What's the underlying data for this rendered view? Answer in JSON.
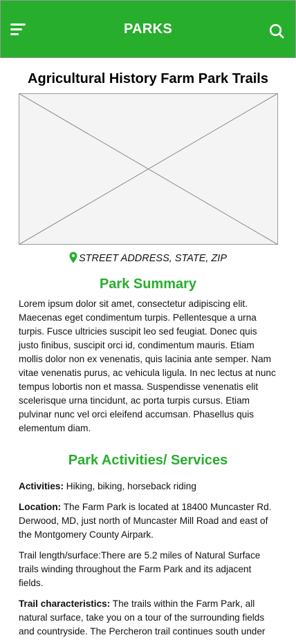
{
  "header": {
    "title": "PARKS",
    "menu_icon": "hamburger-menu-icon",
    "search_icon": "search-icon",
    "bg_color": "#27ae2d"
  },
  "page": {
    "title": "Agricultural History Farm Park Trails",
    "image_placeholder": "image-placeholder",
    "address": "STREET ADDRESS, STATE, ZIP",
    "location_icon": "map-pin-icon"
  },
  "summary": {
    "heading": "Park Summary",
    "text": "Lorem ipsum dolor sit amet, consectetur adipiscing elit. Maecenas eget condimentum turpis. Pellentesque a urna turpis. Fusce ultricies suscipit leo sed feugiat. Donec quis justo finibus, suscipit orci id, condimentum mauris. Etiam mollis dolor non ex venenatis, quis lacinia ante semper. Nam vitae venenatis purus, ac vehicula ligula. In nec lectus at nunc tempus lobortis non et massa. Suspendisse venenatis elit scelerisque urna tincidunt, ac porta turpis cursus. Etiam pulvinar nunc vel orci eleifend accumsan. Phasellus quis elementum diam."
  },
  "activities": {
    "heading": "Park Activities/ Services",
    "activities_label": "Activities:",
    "activities_value": " Hiking, biking, horseback riding",
    "location_label": "Location:",
    "location_value": " The Farm Park is located at 18400 Muncaster Rd. Derwood, MD, just north of Muncaster Mill Road and east of the Montgomery County Airpark.",
    "trail_length": "Trail length/surface:There are 5.2 miles of Natural Surface trails winding throughout the Farm Park and its adjacent fields.",
    "characteristics_label": "Trail characteristics:",
    "characteristics_value": " The trails within the Farm Park, all natural surface, take you on a tour of the surrounding fields and countryside. The Percheron trail continues south under"
  }
}
